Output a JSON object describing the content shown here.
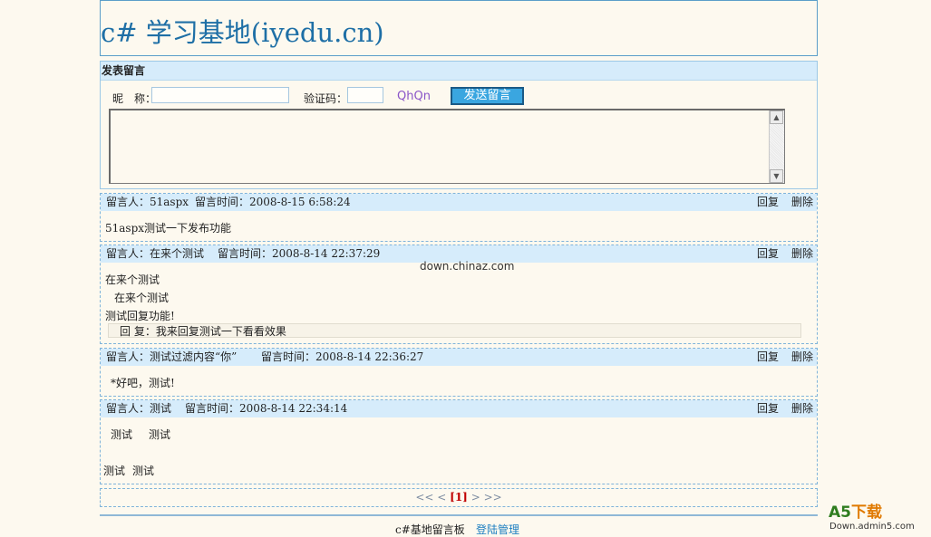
{
  "header": {
    "title": "c# 学习基地(iyedu.cn)"
  },
  "post_form": {
    "section_title": "发表留言",
    "nickname_label": "昵　称：",
    "nickname_value": "",
    "captcha_label": "验证码：",
    "captcha_value": "",
    "captcha_text": "QhQn",
    "submit_label": "发送留言",
    "message_value": ""
  },
  "messages": [
    {
      "author_label": "留言人：51aspx",
      "time_label": "留言时间：2008-8-15 6:58:24",
      "reply": "回复",
      "delete": "删除",
      "lines": [
        "51aspx测试一下发布功能"
      ]
    },
    {
      "author_label": "留言人：在来个测试",
      "time_label": "留言时间：2008-8-14 22:37:29",
      "reply": "回复",
      "delete": "删除",
      "lines": [
        "在来个测试",
        "在来个测试",
        "测试回复功能!"
      ],
      "admin_reply": "回  复：我来回复测试一下看看效果"
    },
    {
      "author_label": "留言人：测试过滤内容“你”",
      "time_label": "留言时间：2008-8-14 22:36:27",
      "reply": "回复",
      "delete": "删除",
      "lines": [
        "*好吧，测试!"
      ]
    },
    {
      "author_label": "留言人：测试",
      "time_label": "留言时间：2008-8-14 22:34:14",
      "reply": "回复",
      "delete": "删除",
      "lines": [
        "测试",
        "测试",
        "测试",
        "测试"
      ]
    }
  ],
  "watermark": "down.chinaz.com",
  "pager": {
    "first": "<<",
    "prev": "<",
    "current": "[1]",
    "next": ">",
    "last": ">>"
  },
  "footer": {
    "board_name": "c#基地留言板",
    "admin_link": "登陆管理"
  },
  "corner_logo": {
    "main": "A5",
    "accent": "下载",
    "sub": "Down.admin5.com"
  }
}
